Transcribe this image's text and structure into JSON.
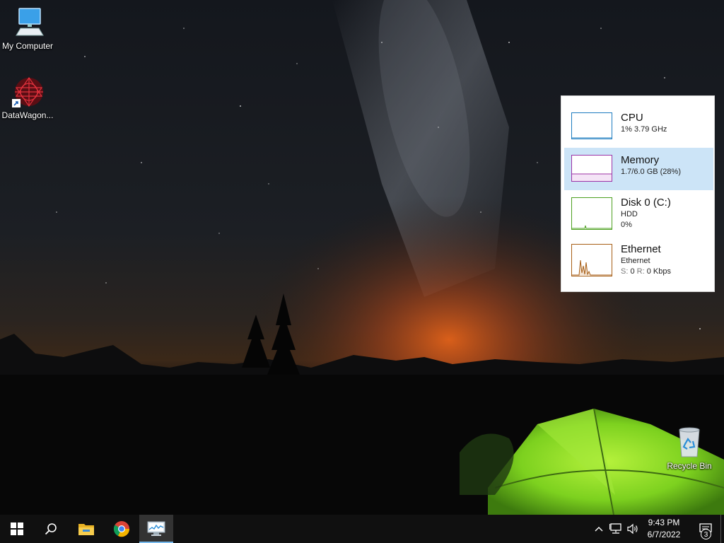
{
  "desktop": {
    "icons": [
      {
        "label": "My Computer"
      },
      {
        "label": "DataWagon..."
      },
      {
        "label": "Recycle Bin"
      }
    ]
  },
  "task_manager": {
    "items": [
      {
        "title": "CPU",
        "line1": "1% 3.79 GHz",
        "color": "#1d7cbf"
      },
      {
        "title": "Memory",
        "line1": "1.7/6.0 GB (28%)",
        "color": "#9b33a6",
        "selected": true
      },
      {
        "title": "Disk 0 (C:)",
        "line1": "HDD",
        "line2": "0%",
        "color": "#4da020"
      },
      {
        "title": "Ethernet",
        "line1": "Ethernet",
        "send_label": "S:",
        "send_value": "0",
        "recv_label": "R:",
        "recv_value": "0 Kbps",
        "color": "#a75e15"
      }
    ]
  },
  "taskbar": {
    "buttons": [
      {
        "icon": "windows-start-icon"
      },
      {
        "icon": "search-icon"
      },
      {
        "icon": "file-explorer-icon"
      },
      {
        "icon": "chrome-icon"
      },
      {
        "icon": "task-manager-icon",
        "active": true
      }
    ],
    "tray": {
      "time": "9:43 PM",
      "date": "6/7/2022",
      "notification_count": "3"
    }
  },
  "colors": {
    "taskbar": "#101010",
    "selection": "#cce4f7",
    "accent": "#76b9ed"
  }
}
